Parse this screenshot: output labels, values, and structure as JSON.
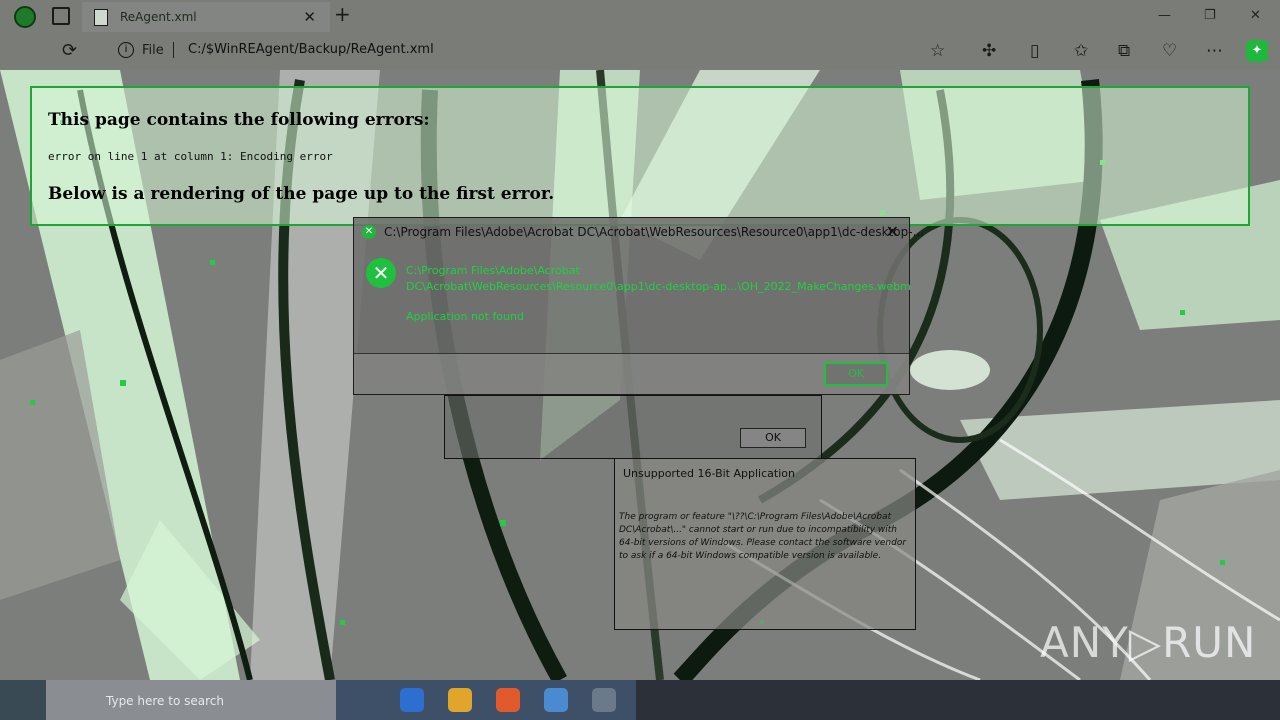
{
  "browser": {
    "tab_title": "ReAgent.xml",
    "address_prefix": "File",
    "url": "C:/$WinREAgent/Backup/ReAgent.xml",
    "icons": [
      "profile-icon",
      "tab-actions-icon",
      "document-icon",
      "close-icon",
      "new-tab-icon",
      "minimize-icon",
      "maximize-icon",
      "close-window-icon",
      "reload-icon",
      "info-icon",
      "star-icon",
      "extensions-icon",
      "split-screen-icon",
      "favorites-icon",
      "collections-icon",
      "performance-icon",
      "more-icon",
      "copilot-icon"
    ]
  },
  "xml_error": {
    "heading": "This page contains the following errors:",
    "message": "error on line 1 at column 1: Encoding error",
    "footer": "Below is a rendering of the page up to the first error."
  },
  "error_dialog": {
    "title": "C:\\Program Files\\Adobe\\Acrobat DC\\Acrobat\\WebResources\\Resource0\\app1\\dc-desktop-...",
    "path_line1": "C:\\Program Files\\Adobe\\Acrobat",
    "path_line2": "DC\\Acrobat\\WebResources\\Resource0\\app1\\dc-desktop-ap...\\OH_2022_MakeChanges.webm",
    "message": "Application not found",
    "ok_label": "OK"
  },
  "back_dialog": {
    "ok_label": "OK"
  },
  "unsupported_dialog": {
    "title": "Unsupported 16-Bit Application",
    "body": "The program or feature \"\\??\\C:\\Program Files\\Adobe\\Acrobat DC\\Acrobat\\...\" cannot start or run due to incompatibility with 64-bit versions of Windows. Please contact the software vendor to ask if a 64-bit Windows compatible version is available."
  },
  "taskbar": {
    "search_text": "Type here to search"
  },
  "watermark": "ANY▷RUN",
  "colors": {
    "accent_green": "#1fc03e",
    "highlight_green": "#d7f8d7",
    "taskbar": "#22262a"
  }
}
